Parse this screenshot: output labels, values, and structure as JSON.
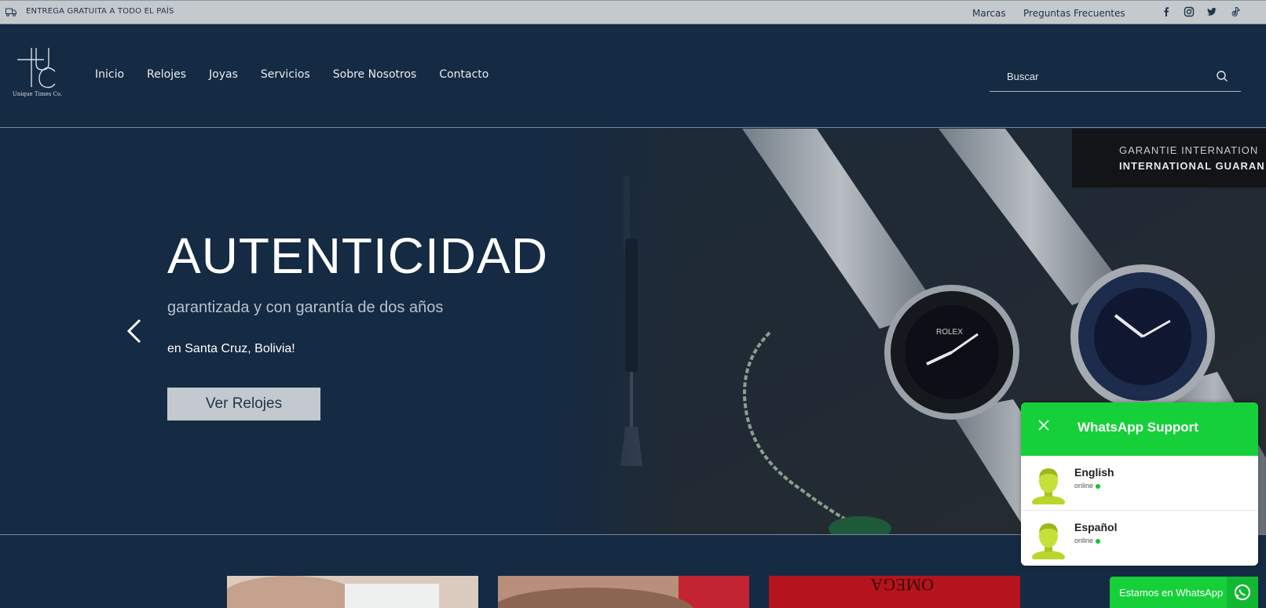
{
  "topbar": {
    "shipping_text": "ENTREGA GRATUITA A TODO EL PAÍS",
    "links": [
      "Marcas",
      "Preguntas Frecuentes"
    ],
    "social_icons": [
      "facebook-icon",
      "instagram-icon",
      "twitter-icon",
      "tiktok-icon"
    ]
  },
  "header": {
    "logo_text": "Unique Times Co.",
    "nav": [
      "Inicio",
      "Relojes",
      "Joyas",
      "Servicios",
      "Sobre Nosotros",
      "Contacto"
    ],
    "search_placeholder": "Buscar"
  },
  "hero": {
    "title": "AUTENTICIDAD",
    "subtitle": "garantizada y con garantía de dos años",
    "location": "en Santa Cruz, Bolivia!",
    "cta": "Ver Relojes",
    "photo_text_line1": "GARANTIE INTERNATION",
    "photo_text_line2": "INTERNATIONAL GUARAN"
  },
  "whatsapp": {
    "title": "WhatsApp Support",
    "agents": [
      {
        "name": "English",
        "status": "online"
      },
      {
        "name": "Español",
        "status": "online"
      }
    ],
    "button_label": "Estamos en WhatsApp"
  },
  "colors": {
    "navy": "#152a43",
    "topbar": "#c3c9cd",
    "whatsapp_green": "#16d03a"
  }
}
